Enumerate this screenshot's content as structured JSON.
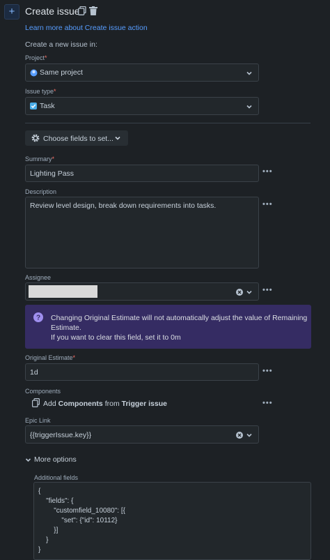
{
  "header": {
    "plus_label": "+",
    "title": "Create issue",
    "copy_icon": "copy-icon",
    "delete_icon": "trash-icon",
    "learn_link": "Learn more about Create issue action"
  },
  "intro": "Create a new issue in:",
  "project": {
    "label": "Project",
    "required": "*",
    "value": "Same project"
  },
  "issue_type": {
    "label": "Issue type",
    "required": "*",
    "value": "Task"
  },
  "choose_fields": {
    "label": "Choose fields to set..."
  },
  "summary": {
    "label": "Summary",
    "required": "*",
    "value": "Lighting Pass"
  },
  "description": {
    "label": "Description",
    "value": "Review level design, break down requirements into tasks."
  },
  "assignee": {
    "label": "Assignee",
    "value": ""
  },
  "banner": {
    "line1": "Changing Original Estimate will not automatically adjust the value of Remaining",
    "line2": "Estimate.",
    "line3": "If you want to clear this field, set it to 0m"
  },
  "original_estimate": {
    "label": "Original Estimate",
    "required": "*",
    "value": "1d"
  },
  "components": {
    "label": "Components",
    "add": "Add",
    "components_word": "Components",
    "from": "from",
    "source": "Trigger issue"
  },
  "epic_link": {
    "label": "Epic Link",
    "value": "{{triggerIssue.key}}"
  },
  "more_options": {
    "label": "More options"
  },
  "additional_fields": {
    "label": "Additional fields",
    "lines": [
      "{",
      "    \"fields\": {",
      "        \"customfield_10080\": [{",
      "            \"set\": {\"id\": 10112}",
      "        }]",
      "    }",
      "}"
    ]
  },
  "colors": {
    "background": "#1d2125",
    "link": "#579dff",
    "required": "#f87168",
    "banner": "#352c63",
    "field": "#22272b"
  }
}
